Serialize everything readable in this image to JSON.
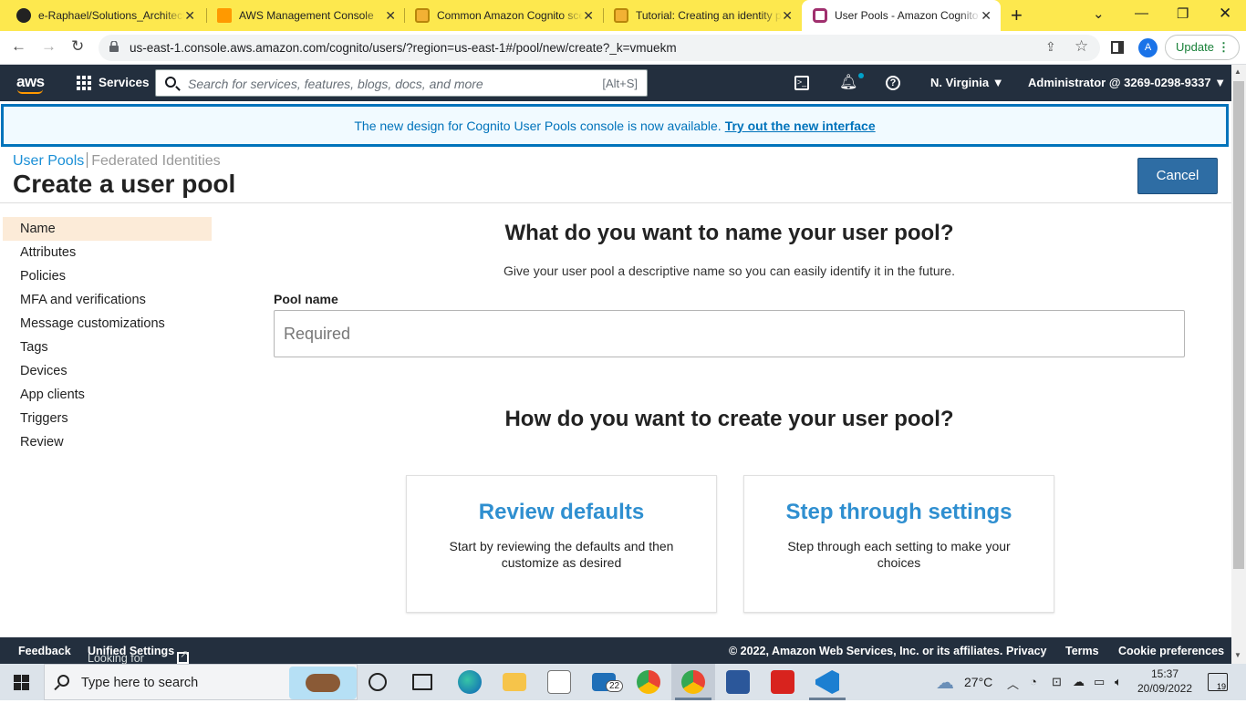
{
  "browser": {
    "tabs": [
      {
        "title": "e-Raphael/Solutions_Architect",
        "icon": "github-icon"
      },
      {
        "title": "AWS Management Console",
        "icon": "aws-cube-icon"
      },
      {
        "title": "Common Amazon Cognito scenarios",
        "icon": "aws-docs-icon"
      },
      {
        "title": "Tutorial: Creating an identity pool",
        "icon": "aws-docs-icon"
      },
      {
        "title": "User Pools - Amazon Cognito",
        "icon": "cognito-icon",
        "active": true
      }
    ],
    "new_tab": "+",
    "url": "us-east-1.console.aws.amazon.com/cognito/users/?region=us-east-1#/pool/new/create?_k=vmuekm",
    "profile_initial": "A",
    "update_label": "Update"
  },
  "aws_nav": {
    "logo": "aws",
    "services": "Services",
    "search_placeholder": "Search for services, features, blogs, docs, and more",
    "search_shortcut": "[Alt+S]",
    "region": "N. Virginia",
    "account": "Administrator @ 3269-0298-9337"
  },
  "banner": {
    "message": "The new design for Cognito User Pools console is now available.",
    "link": "Try out the new interface"
  },
  "breadcrumb": {
    "user_pools": "User Pools",
    "federated": "Federated Identities"
  },
  "page": {
    "title": "Create a user pool",
    "cancel": "Cancel"
  },
  "sidenav": {
    "items": [
      "Name",
      "Attributes",
      "Policies",
      "MFA and verifications",
      "Message customizations",
      "Tags",
      "Devices",
      "App clients",
      "Triggers",
      "Review"
    ],
    "active": "Name"
  },
  "main": {
    "name_heading": "What do you want to name your user pool?",
    "name_desc": "Give your user pool a descriptive name so you can easily identify it in the future.",
    "pool_name_label": "Pool name",
    "pool_name_placeholder": "Required",
    "pool_name_value": "",
    "create_heading": "How do you want to create your user pool?",
    "cards": [
      {
        "title": "Review defaults",
        "desc": "Start by reviewing the defaults and then customize as desired"
      },
      {
        "title": "Step through settings",
        "desc": "Step through each setting to make your choices"
      }
    ]
  },
  "footer": {
    "feedback": "Feedback",
    "language_note": "Looking for language selection? Find it in the new",
    "unified_settings": "Unified Settings",
    "copyright": "© 2022, Amazon Web Services, Inc. or its affiliates.",
    "privacy": "Privacy",
    "terms": "Terms",
    "cookie": "Cookie preferences"
  },
  "taskbar": {
    "search_placeholder": "Type here to search",
    "mail_badge": "22",
    "temperature": "27°C",
    "time": "15:37",
    "date": "20/09/2022",
    "notifications": "19"
  },
  "colors": {
    "tabstrip": "#fde84e",
    "aws_nav": "#232f3e",
    "aws_orange": "#ff9900",
    "link_blue": "#0073bb",
    "cancel_button": "#2e6da4",
    "active_nav": "#fcebd8",
    "card_title": "#2f8fd0"
  }
}
